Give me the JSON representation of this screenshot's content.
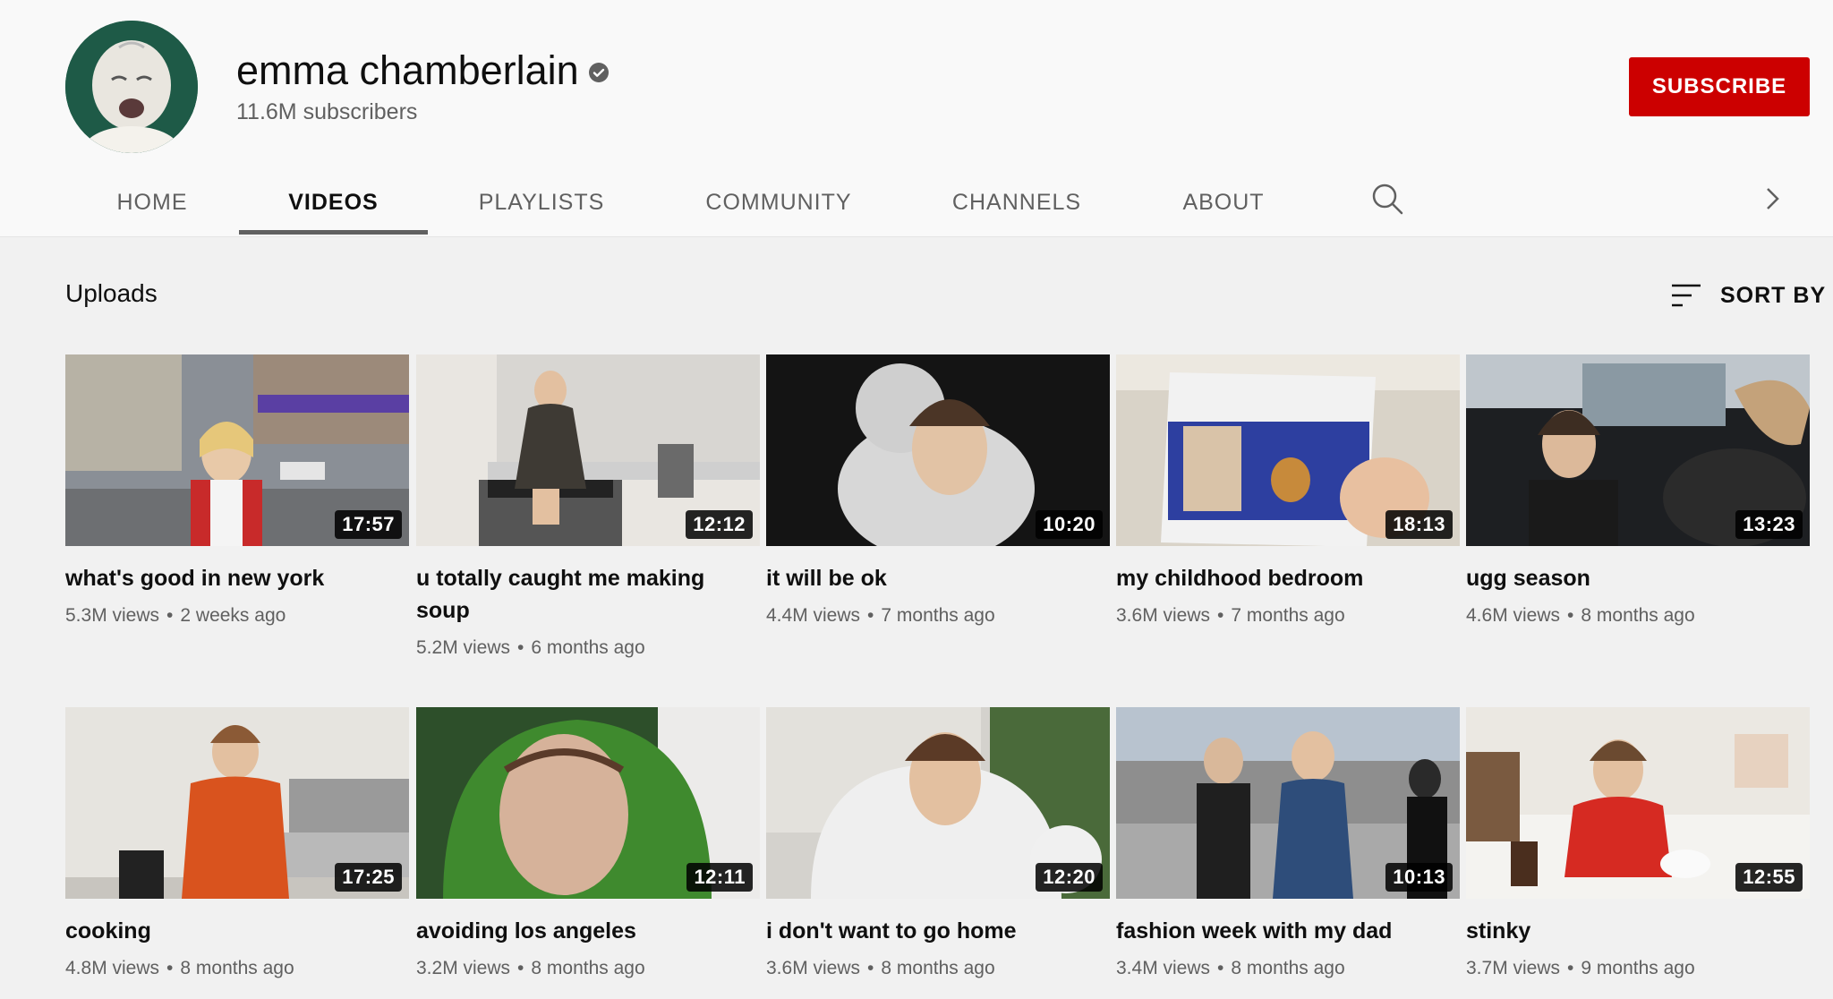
{
  "channel": {
    "name": "emma chamberlain",
    "subscribers": "11.6M subscribers",
    "subscribe_label": "SUBSCRIBE",
    "icons": {
      "avatar": "avatar",
      "verified": "verified-check-icon"
    }
  },
  "tabs": [
    {
      "label": "HOME"
    },
    {
      "label": "VIDEOS",
      "active": true
    },
    {
      "label": "PLAYLISTS"
    },
    {
      "label": "COMMUNITY"
    },
    {
      "label": "CHANNELS"
    },
    {
      "label": "ABOUT"
    }
  ],
  "tab_icons": {
    "search": "search-icon",
    "next": "chevron-right-icon"
  },
  "uploads": {
    "title": "Uploads",
    "sort_label": "SORT BY",
    "sort_icon": "sort-icon"
  },
  "videos": [
    {
      "title": "what's good in new york",
      "duration": "17:57",
      "views": "5.3M views",
      "age": "2 weeks ago"
    },
    {
      "title": "u totally caught me making soup",
      "duration": "12:12",
      "views": "5.2M views",
      "age": "6 months ago"
    },
    {
      "title": "it will be ok",
      "duration": "10:20",
      "views": "4.4M views",
      "age": "7 months ago"
    },
    {
      "title": "my childhood bedroom",
      "duration": "18:13",
      "views": "3.6M views",
      "age": "7 months ago"
    },
    {
      "title": "ugg season",
      "duration": "13:23",
      "views": "4.6M views",
      "age": "8 months ago"
    },
    {
      "title": "cooking",
      "duration": "17:25",
      "views": "4.8M views",
      "age": "8 months ago"
    },
    {
      "title": "avoiding los angeles",
      "duration": "12:11",
      "views": "3.2M views",
      "age": "8 months ago"
    },
    {
      "title": "i don't want to go home",
      "duration": "12:20",
      "views": "3.6M views",
      "age": "8 months ago"
    },
    {
      "title": "fashion week with my dad",
      "duration": "10:13",
      "views": "3.4M views",
      "age": "8 months ago"
    },
    {
      "title": "stinky",
      "duration": "12:55",
      "views": "3.7M views",
      "age": "9 months ago"
    }
  ],
  "colors": {
    "subscribe": "#cc0000",
    "background": "#f9f9f9",
    "content_background": "#f1f1f1",
    "secondary_text": "#606060"
  }
}
